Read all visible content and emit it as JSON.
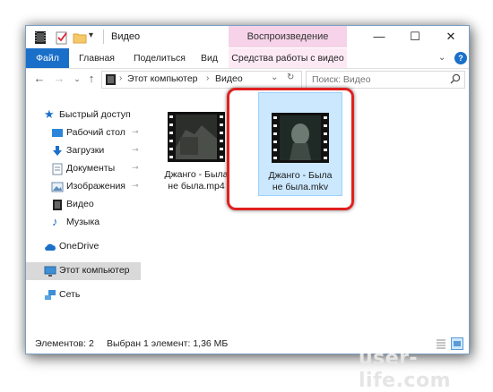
{
  "window": {
    "title": "Видео",
    "contextual_tab": "Воспроизведение",
    "controls": {
      "minimize": "—",
      "maximize": "☐",
      "close": "✕"
    }
  },
  "ribbon": {
    "tabs": [
      "Файл",
      "Главная",
      "Поделиться",
      "Вид",
      "Средства работы с видео"
    ],
    "chevron": "⌄"
  },
  "address": {
    "path": [
      "Этот компьютер",
      "Видео"
    ],
    "separator": "›",
    "dropdown": "⌄",
    "refresh": "↻"
  },
  "search": {
    "placeholder": "Поиск: Видео"
  },
  "sidebar": {
    "items": [
      {
        "label": "Быстрый доступ",
        "icon": "star-icon"
      },
      {
        "label": "Рабочий стол",
        "icon": "desktop-icon",
        "pinned": true
      },
      {
        "label": "Загрузки",
        "icon": "downloads-icon",
        "pinned": true
      },
      {
        "label": "Документы",
        "icon": "documents-icon",
        "pinned": true
      },
      {
        "label": "Изображения",
        "icon": "pictures-icon",
        "pinned": true
      },
      {
        "label": "Видео",
        "icon": "videos-icon"
      },
      {
        "label": "Музыка",
        "icon": "music-icon"
      },
      {
        "label": "OneDrive",
        "icon": "cloud-icon"
      },
      {
        "label": "Этот компьютер",
        "icon": "computer-icon",
        "selected": true
      },
      {
        "label": "Сеть",
        "icon": "network-icon"
      }
    ],
    "pin_glyph": "📌"
  },
  "files": [
    {
      "line1": "Джанго - Была",
      "line2": "не была.mp4",
      "selected": false
    },
    {
      "line1": "Джанго - Была",
      "line2": "не была.mkv",
      "selected": true
    }
  ],
  "status": {
    "count": "Элементов: 2",
    "selection": "Выбран 1 элемент: 1,36 МБ"
  },
  "watermark": "user-life.com",
  "colors": {
    "accent": "#1a6fc9",
    "context_tab": "#f6d3e8",
    "selection": "#cce8ff",
    "highlight": "#e02020"
  }
}
